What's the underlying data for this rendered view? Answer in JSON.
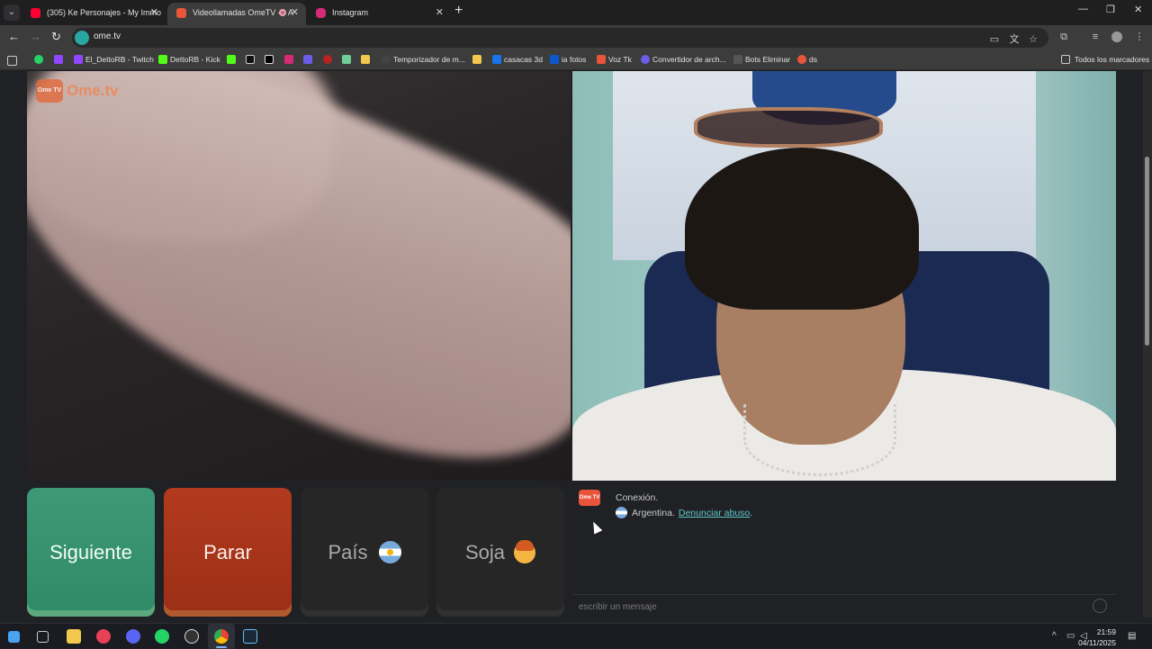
{
  "tabs": [
    {
      "title": "(305) Ke Personajes - My Immo",
      "favicon_color": "#ff0033",
      "active": false
    },
    {
      "title": "Videollamadas OmeTV — A",
      "favicon_color": "#e8553b",
      "active": true
    },
    {
      "title": "Instagram",
      "favicon_color": "#d62976",
      "active": false
    }
  ],
  "address_bar": {
    "url": "ome.tv"
  },
  "bookmarks": [
    {
      "label": "El_DettoRB - Twitch",
      "color": "#9146ff"
    },
    {
      "label": "DettoRB - Kick",
      "color": "#53fc18"
    },
    {
      "label": "Temporizador de m...",
      "color": "#444444"
    },
    {
      "label": "casacas 3d",
      "color": "#1a73e8"
    },
    {
      "label": "ia fotos",
      "color": "#0b57d0"
    },
    {
      "label": "Voz Tk",
      "color": "#e8553b"
    },
    {
      "label": "Convertidor de arch...",
      "color": "#6c5ce7"
    },
    {
      "label": "Bots Eliminar",
      "color": "#555555"
    },
    {
      "label": "ds",
      "color": "#e8553b"
    }
  ],
  "all_bookmarks_label": "Todos los marcadores",
  "site": {
    "logo_text": "Ome.tv",
    "logo_badge": "Ome TV"
  },
  "controls": {
    "next_label": "Siguiente",
    "stop_label": "Parar",
    "country_label": "País",
    "gender_label": "Soja"
  },
  "chat": {
    "badge": "Ome TV",
    "status": "Conexión.",
    "country": "Argentina",
    "separator": " .",
    "report_link": "Denunciar abuso",
    "report_suffix": ".",
    "input_placeholder": "escribir un mensaje"
  },
  "taskbar": {
    "time": "21:59",
    "date": "04/11/2025"
  }
}
